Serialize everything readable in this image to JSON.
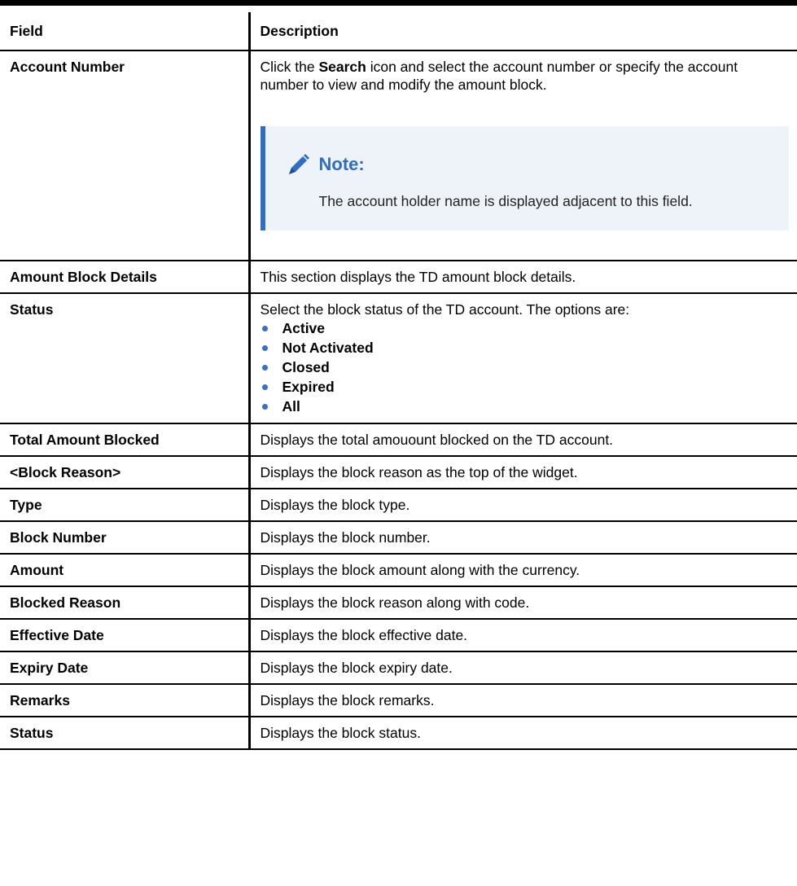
{
  "table": {
    "header": {
      "field": "Field",
      "description": "Description"
    },
    "account_row": {
      "field": "Account Number",
      "desc_pre": "Click the ",
      "desc_bold": "Search",
      "desc_post": " icon and select the account number or specify the account number to view and modify the amount block.",
      "note": {
        "icon": "pencil-icon",
        "title": "Note:",
        "text": "The account holder name is displayed adjacent to this field."
      }
    },
    "amount_block_row": {
      "field": "Amount Block Details",
      "description": "This section displays the TD amount block details."
    },
    "status_row": {
      "field": "Status",
      "description": "Select the block status of the TD account. The options are:",
      "options": [
        "Active",
        "Not Activated",
        "Closed",
        "Expired",
        "All"
      ]
    },
    "rows": [
      {
        "field": "Total Amount Blocked",
        "description": "Displays the total amouount blocked on the TD account."
      },
      {
        "field": "<Block Reason>",
        "description": "Displays the block reason as the top of the widget."
      },
      {
        "field": "Type",
        "description": "Displays the block type."
      },
      {
        "field": "Block Number",
        "description": "Displays the block number."
      },
      {
        "field": "Amount",
        "description": "Displays the block amount along with the currency."
      },
      {
        "field": "Blocked Reason",
        "description": "Displays the block reason along with code."
      },
      {
        "field": "Effective Date",
        "description": "Displays the block effective date."
      },
      {
        "field": "Expiry Date",
        "description": "Displays the block expiry date."
      },
      {
        "field": "Remarks",
        "description": "Displays the block remarks."
      },
      {
        "field": "Status",
        "description": "Displays the block status."
      }
    ]
  },
  "colors": {
    "note_accent": "#2f6ec4",
    "note_background": "#eef3f9",
    "bullet": "#3b6fc5"
  }
}
